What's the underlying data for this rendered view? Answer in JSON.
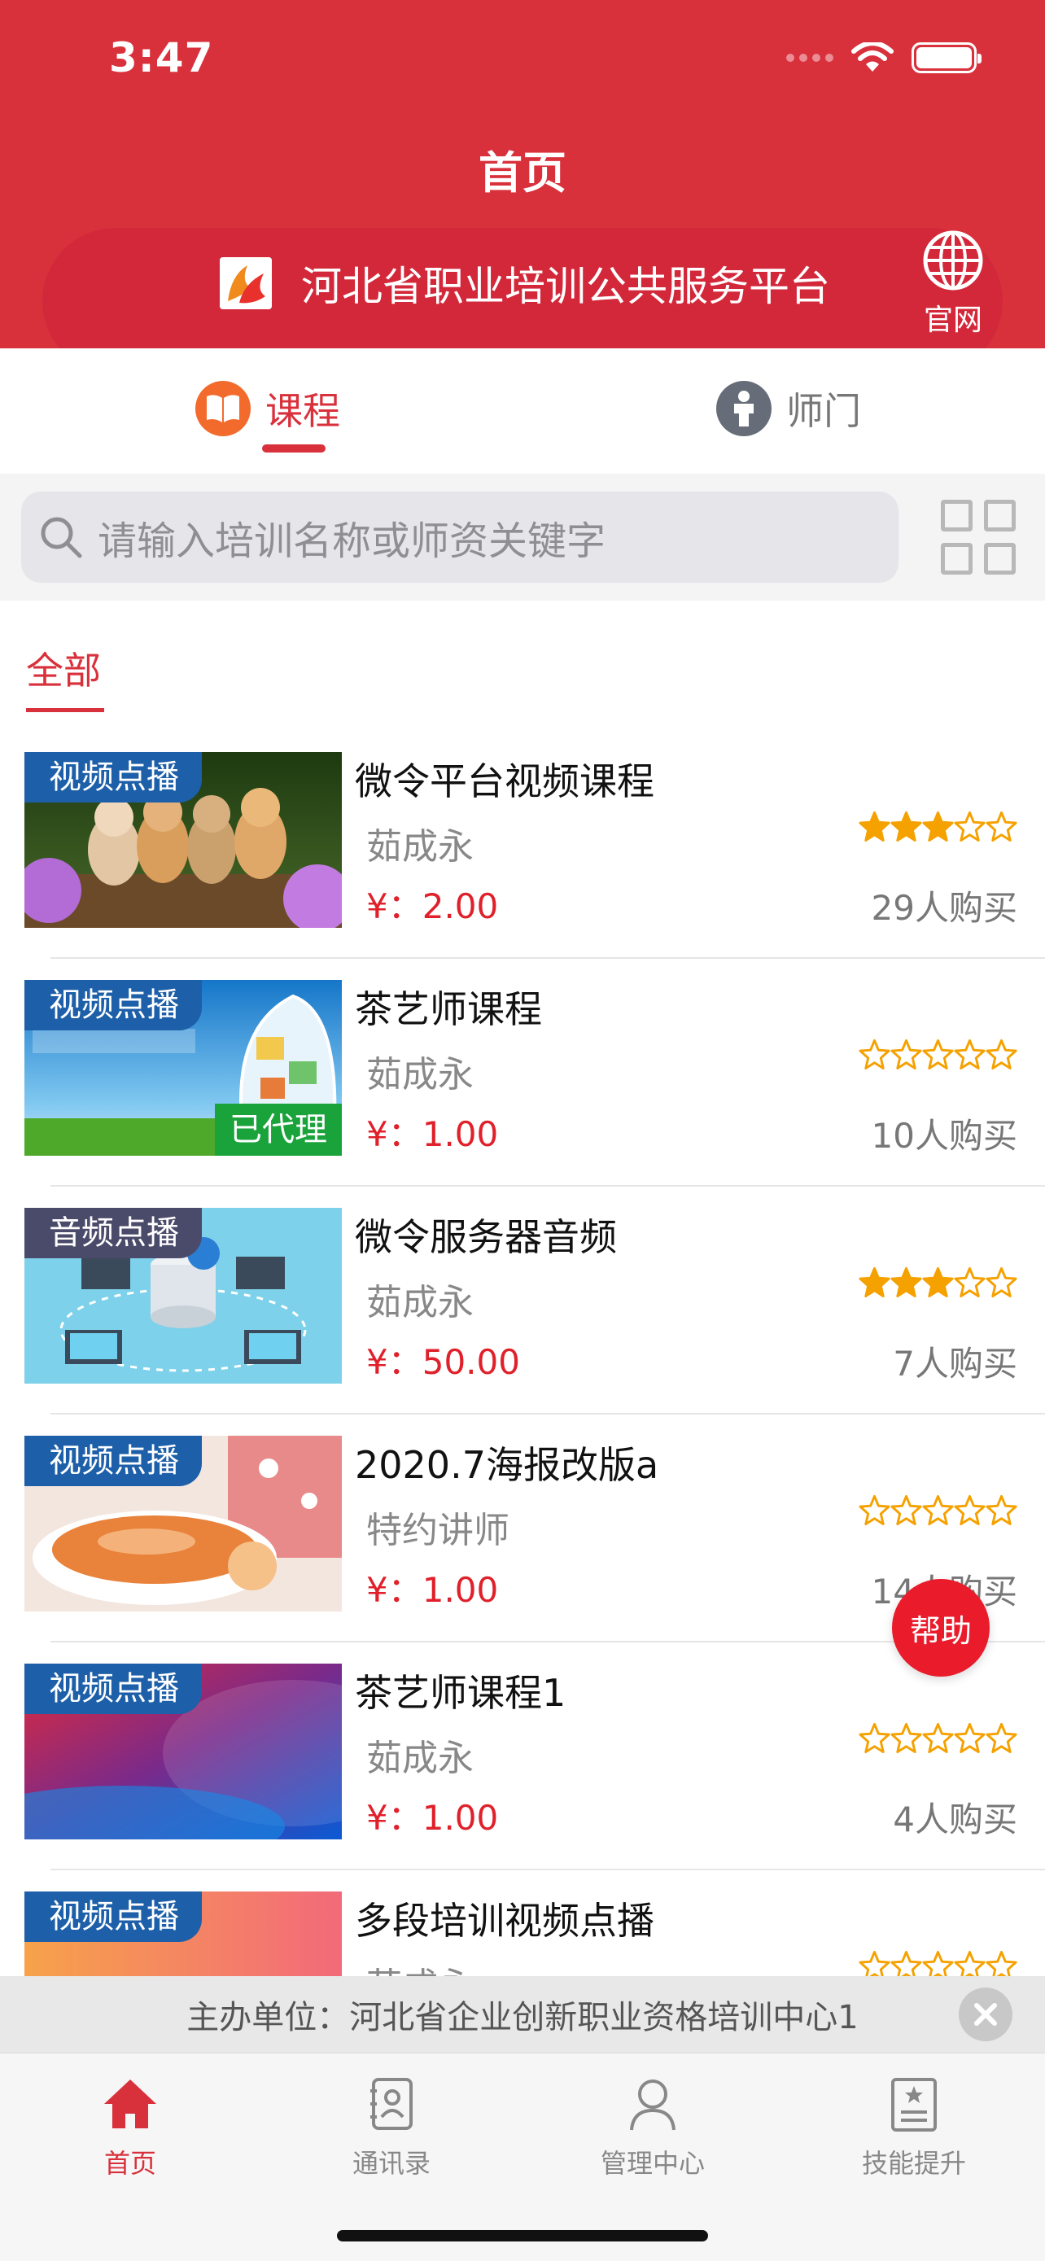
{
  "status_bar": {
    "time": "3:47"
  },
  "header": {
    "title": "首页",
    "platform_name": "河北省职业培训公共服务平台",
    "website_label": "官网"
  },
  "top_tabs": [
    {
      "label": "课程",
      "active": true,
      "icon": "book-icon"
    },
    {
      "label": "师门",
      "active": false,
      "icon": "person-icon"
    }
  ],
  "search": {
    "placeholder": "请输入培训名称或师资关键字"
  },
  "categories": [
    {
      "label": "全部",
      "active": true
    }
  ],
  "courses": [
    {
      "badge": "视频点播",
      "title": "微令平台视频课程",
      "teacher": "茹成永",
      "price": "¥：2.00",
      "rating": 3,
      "buyers": "29人购买",
      "agent_badge": ""
    },
    {
      "badge": "视频点播",
      "title": "茶艺师课程",
      "teacher": "茹成永",
      "price": "¥：1.00",
      "rating": 0,
      "buyers": "10人购买",
      "agent_badge": "已代理"
    },
    {
      "badge": "音频点播",
      "title": "微令服务器音频",
      "teacher": "茹成永",
      "price": "¥：50.00",
      "rating": 3,
      "buyers": "7人购买",
      "agent_badge": ""
    },
    {
      "badge": "视频点播",
      "title": "2020.7海报改版a",
      "teacher": "特约讲师",
      "price": "¥：1.00",
      "rating": 0,
      "buyers": "14人购买",
      "agent_badge": ""
    },
    {
      "badge": "视频点播",
      "title": "茶艺师课程1",
      "teacher": "茹成永",
      "price": "¥：1.00",
      "rating": 0,
      "buyers": "4人购买",
      "agent_badge": ""
    },
    {
      "badge": "视频点播",
      "title": "多段培训视频点播",
      "teacher": "茹成永",
      "price": "",
      "rating": 0,
      "buyers": "",
      "agent_badge": ""
    }
  ],
  "help_button": "帮助",
  "sponsor": {
    "text": "主办单位：河北省企业创新职业资格培训中心1"
  },
  "bottom_nav": [
    {
      "label": "首页",
      "icon": "home-icon",
      "active": true
    },
    {
      "label": "通讯录",
      "icon": "contacts-icon",
      "active": false
    },
    {
      "label": "管理中心",
      "icon": "user-icon",
      "active": false
    },
    {
      "label": "技能提升",
      "icon": "certificate-icon",
      "active": false
    }
  ],
  "colors": {
    "brand_red": "#d9313c",
    "price_red": "#e0202a",
    "star_orange": "#f5a100",
    "video_badge": "#1d5fa8",
    "agent_green": "#19a33a"
  }
}
